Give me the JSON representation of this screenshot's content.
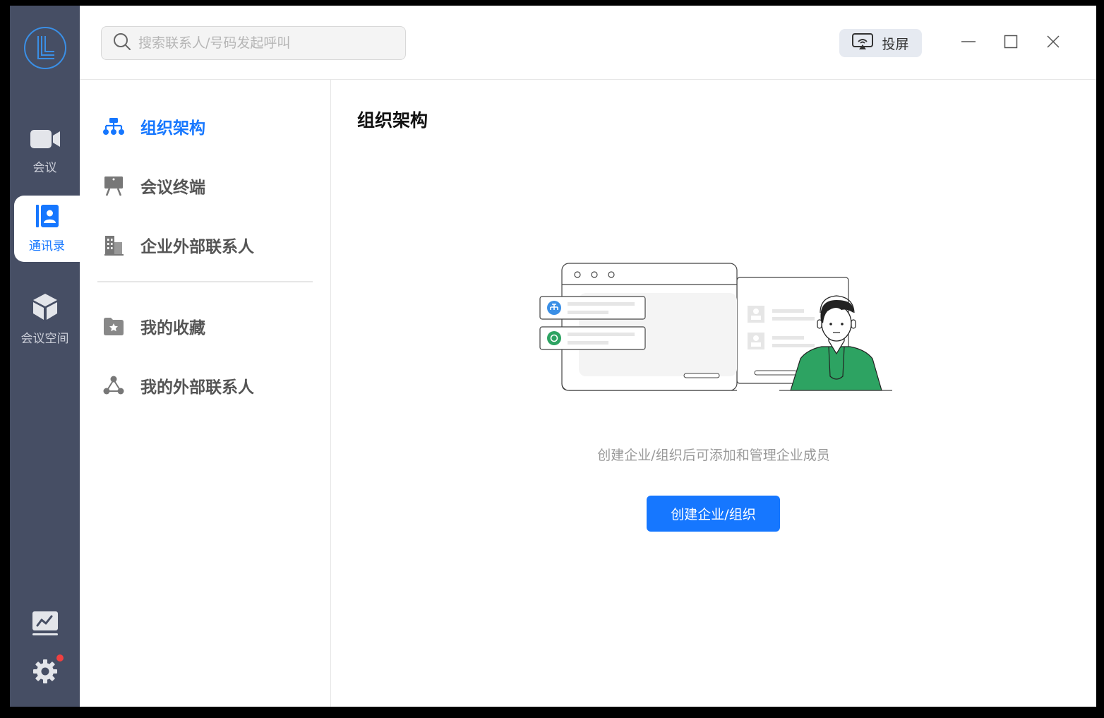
{
  "search": {
    "placeholder": "搜索联系人/号码发起呼叫"
  },
  "header": {
    "cast_label": "投屏"
  },
  "rail": {
    "items": [
      {
        "label": "会议",
        "icon": "video-camera-icon"
      },
      {
        "label": "通讯录",
        "icon": "contacts-book-icon",
        "active": true
      },
      {
        "label": "会议空间",
        "icon": "cube-icon"
      }
    ],
    "bottom": [
      {
        "icon": "whiteboard-chart-icon"
      },
      {
        "icon": "gear-icon",
        "badge": true
      }
    ]
  },
  "nav": {
    "items": [
      {
        "label": "组织架构",
        "icon": "org-tree-icon",
        "active": true
      },
      {
        "label": "会议终端",
        "icon": "presentation-board-icon"
      },
      {
        "label": "企业外部联系人",
        "icon": "building-icon"
      },
      {
        "label": "我的收藏",
        "icon": "star-folder-icon"
      },
      {
        "label": "我的外部联系人",
        "icon": "share-nodes-icon"
      }
    ]
  },
  "main": {
    "title": "组织架构",
    "description": "创建企业/组织后可添加和管理企业成员",
    "create_button": "创建企业/组织"
  },
  "colors": {
    "accent": "#1677ff",
    "rail_bg": "#464e64",
    "illustration_green": "#2da362",
    "badge_red": "#f04040"
  }
}
